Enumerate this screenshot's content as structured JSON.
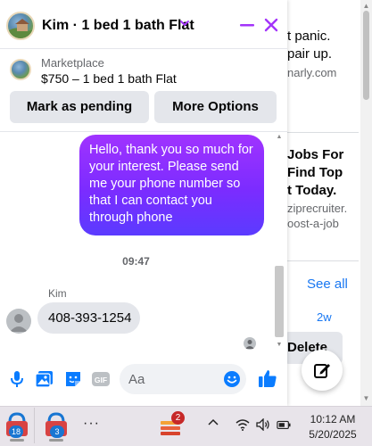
{
  "background_page": {
    "line1": "t panic.",
    "line2": "pair up.",
    "line3": "narly.com",
    "ad_line1": "Jobs For",
    "ad_line2": "Find Top",
    "ad_line3": "t Today.",
    "ad_sub1": "ziprecruiter.",
    "ad_sub2": "oost-a-job",
    "see_all": "See all",
    "time_ago": "2w",
    "delete_label": "Delete"
  },
  "chat": {
    "title": "Kim · 1 bed 1 bath Flat",
    "marketplace_label": "Marketplace",
    "listing": "$750 – 1 bed 1 bath Flat",
    "mark_pending_label": "Mark as pending",
    "more_options_label": "More Options",
    "outgoing_message": "Hello, thank you so much for your interest. Please send me your phone number so that I can contact you through phone",
    "timestamp": "09:47",
    "sender_name": "Kim",
    "incoming_message": "408-393-1254",
    "input_placeholder": "Aa"
  },
  "colors": {
    "accent_purple": "#a033ff",
    "header_icon": "#a334fa",
    "composer_icon": "#0a7cff",
    "link_blue": "#1877f2"
  },
  "icons": {
    "composer": [
      "microphone-icon",
      "photo-icon",
      "sticker-icon",
      "gif-icon",
      "emoji-icon",
      "thumbs-up-icon"
    ],
    "header": [
      "chevron-down-icon",
      "minimize-icon",
      "close-icon"
    ]
  },
  "taskbar": {
    "badge1": "18",
    "badge2": "3",
    "badge3": "2",
    "more": "···",
    "time": "10:12 AM",
    "date": "5/20/2025"
  }
}
